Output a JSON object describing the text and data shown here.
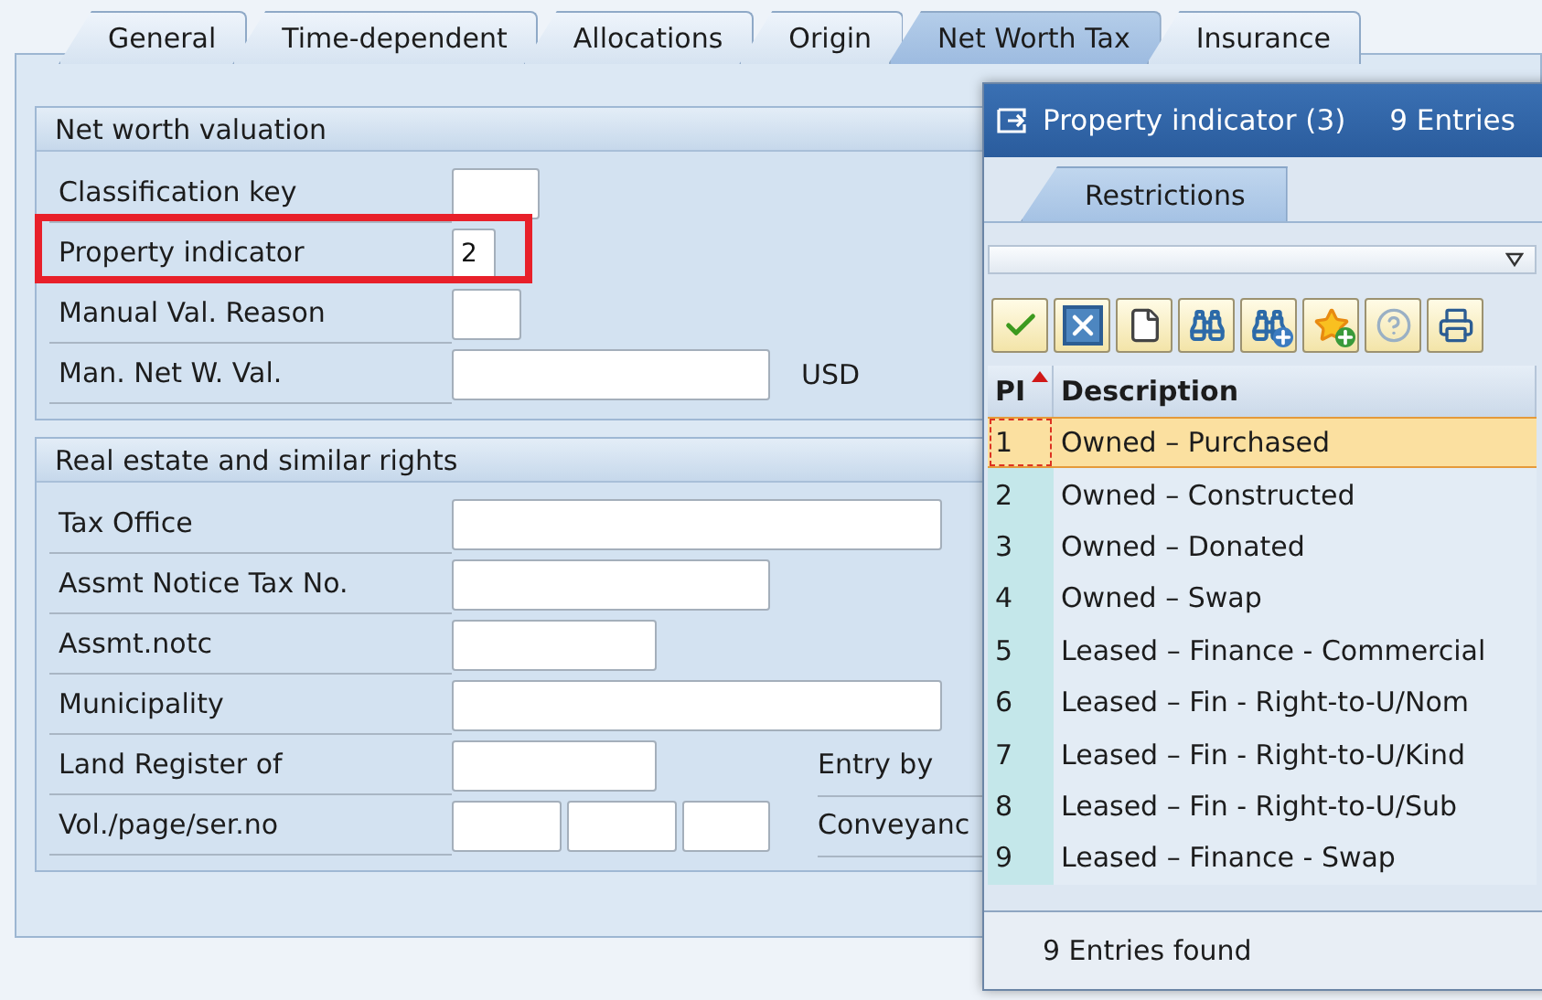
{
  "tabs": [
    {
      "label": "General",
      "selected": false
    },
    {
      "label": "Time-dependent",
      "selected": false
    },
    {
      "label": "Allocations",
      "selected": false
    },
    {
      "label": "Origin",
      "selected": false
    },
    {
      "label": "Net Worth Tax",
      "selected": true
    },
    {
      "label": "Insurance",
      "selected": false
    }
  ],
  "net_worth_valuation": {
    "title": "Net worth valuation",
    "fields": [
      {
        "label": "Classification key",
        "highlighted": false
      },
      {
        "label": "Property indicator",
        "value": "2",
        "highlighted": true
      },
      {
        "label": "Manual Val. Reason",
        "highlighted": false
      },
      {
        "label": "Man. Net W. Val.",
        "unit": "USD",
        "highlighted": false
      }
    ]
  },
  "real_estate": {
    "title": "Real estate and similar rights",
    "fields": [
      {
        "label": "Tax Office"
      },
      {
        "label": "Assmt Notice Tax No."
      },
      {
        "label": "Assmt.notc"
      },
      {
        "label": "Municipality"
      },
      {
        "label": "Land Register of",
        "side_label": "Entry by"
      },
      {
        "label": "Vol./page/ser.no",
        "side_label": "Conveyanc"
      }
    ]
  },
  "popup": {
    "title": "Property indicator (3)",
    "entries": "9 Entries",
    "tabs": [
      {
        "label": "Restrictions",
        "selected": true
      }
    ],
    "columns": [
      {
        "label": "PI",
        "sorted": true
      },
      {
        "label": "Description",
        "sorted": false
      }
    ],
    "rows": [
      {
        "pi": "1",
        "description": "Owned – Purchased",
        "selected": true
      },
      {
        "pi": "2",
        "description": "Owned – Constructed",
        "selected": false
      },
      {
        "pi": "3",
        "description": "Owned – Donated",
        "selected": false
      },
      {
        "pi": "4",
        "description": "Owned – Swap",
        "selected": false
      },
      {
        "pi": "5",
        "description": "Leased – Finance - Commercial",
        "selected": false
      },
      {
        "pi": "6",
        "description": "Leased – Fin - Right-to-U/Nom",
        "selected": false
      },
      {
        "pi": "7",
        "description": "Leased – Fin - Right-to-U/Kind",
        "selected": false
      },
      {
        "pi": "8",
        "description": "Leased – Fin - Right-to-U/Sub",
        "selected": false
      },
      {
        "pi": "9",
        "description": "Leased – Finance - Swap",
        "selected": false
      }
    ],
    "footer": "9 Entries found"
  }
}
